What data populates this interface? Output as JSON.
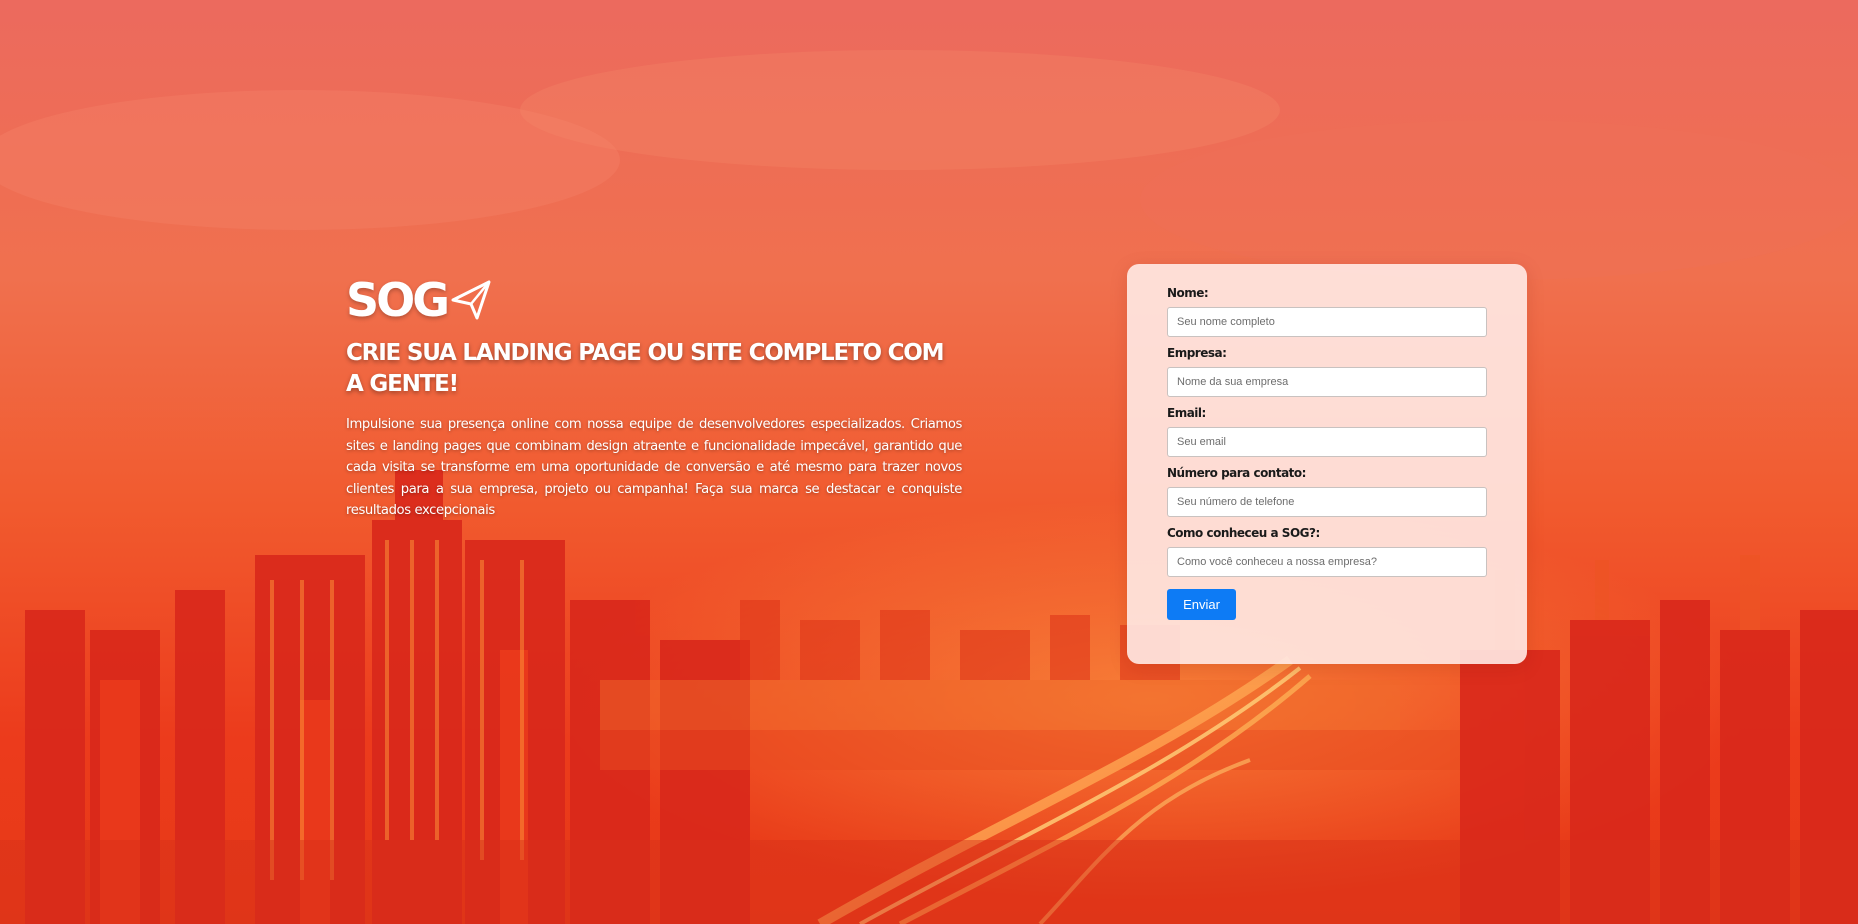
{
  "brand": {
    "logo_text": "SOG",
    "accent_color": "#0d7bf5",
    "overlay_color": "#f15a2e"
  },
  "hero": {
    "title": "CRIE SUA LANDING PAGE OU SITE COMPLETO COM A GENTE!",
    "description": "Impulsione sua presença online com nossa equipe de desenvolvedores especializados. Criamos sites e landing pages que combinam design atraente e funcionalidade impecável, garantido que cada visita se transforme em uma oportunidade de conversão e até mesmo para trazer novos clientes para a sua empresa, projeto ou campanha! Faça sua marca se destacar e conquiste resultados excepcionais"
  },
  "form": {
    "fields": [
      {
        "label": "Nome:",
        "placeholder": "Seu nome completo"
      },
      {
        "label": "Empresa:",
        "placeholder": "Nome da sua empresa"
      },
      {
        "label": "Email:",
        "placeholder": "Seu email"
      },
      {
        "label": "Número para contato:",
        "placeholder": "Seu número de telefone"
      },
      {
        "label": "Como conheceu a SOG?:",
        "placeholder": "Como você conheceu a nossa empresa?"
      }
    ],
    "submit_label": "Enviar"
  }
}
